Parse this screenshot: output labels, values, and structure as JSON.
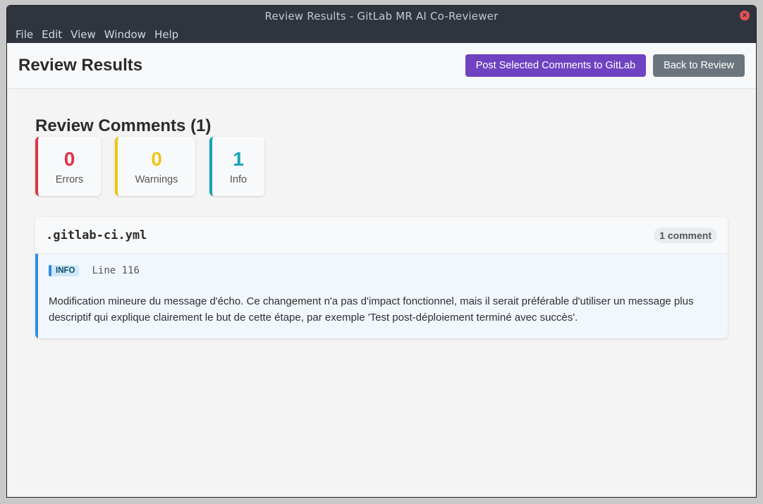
{
  "window": {
    "title": "Review Results - GitLab MR AI Co-Reviewer",
    "close_icon": "close-icon"
  },
  "menu": [
    "File",
    "Edit",
    "View",
    "Window",
    "Help"
  ],
  "header": {
    "title": "Review Results",
    "post_button": "Post Selected Comments to GitLab",
    "back_button": "Back to Review"
  },
  "comments_section": {
    "title": "Review Comments (1)",
    "stats": {
      "errors": {
        "value": "0",
        "label": "Errors"
      },
      "warnings": {
        "value": "0",
        "label": "Warnings"
      },
      "info": {
        "value": "1",
        "label": "Info"
      }
    },
    "files": [
      {
        "name": ".gitlab-ci.yml",
        "count": "1 comment",
        "comments": [
          {
            "severity": "INFO",
            "line": "Line 116",
            "text": "Modification mineure du message d'écho. Ce changement n'a pas d'impact fonctionnel, mais il serait préférable d'utiliser un message plus descriptif qui explique clairement le but de cette étape, par exemple 'Test post-déploiement terminé avec succès'."
          }
        ]
      }
    ]
  },
  "colors": {
    "primary": "#6f42c1",
    "secondary": "#6c757d",
    "error": "#dc3545",
    "warning": "#f0c419",
    "info": "#17a2b8"
  }
}
